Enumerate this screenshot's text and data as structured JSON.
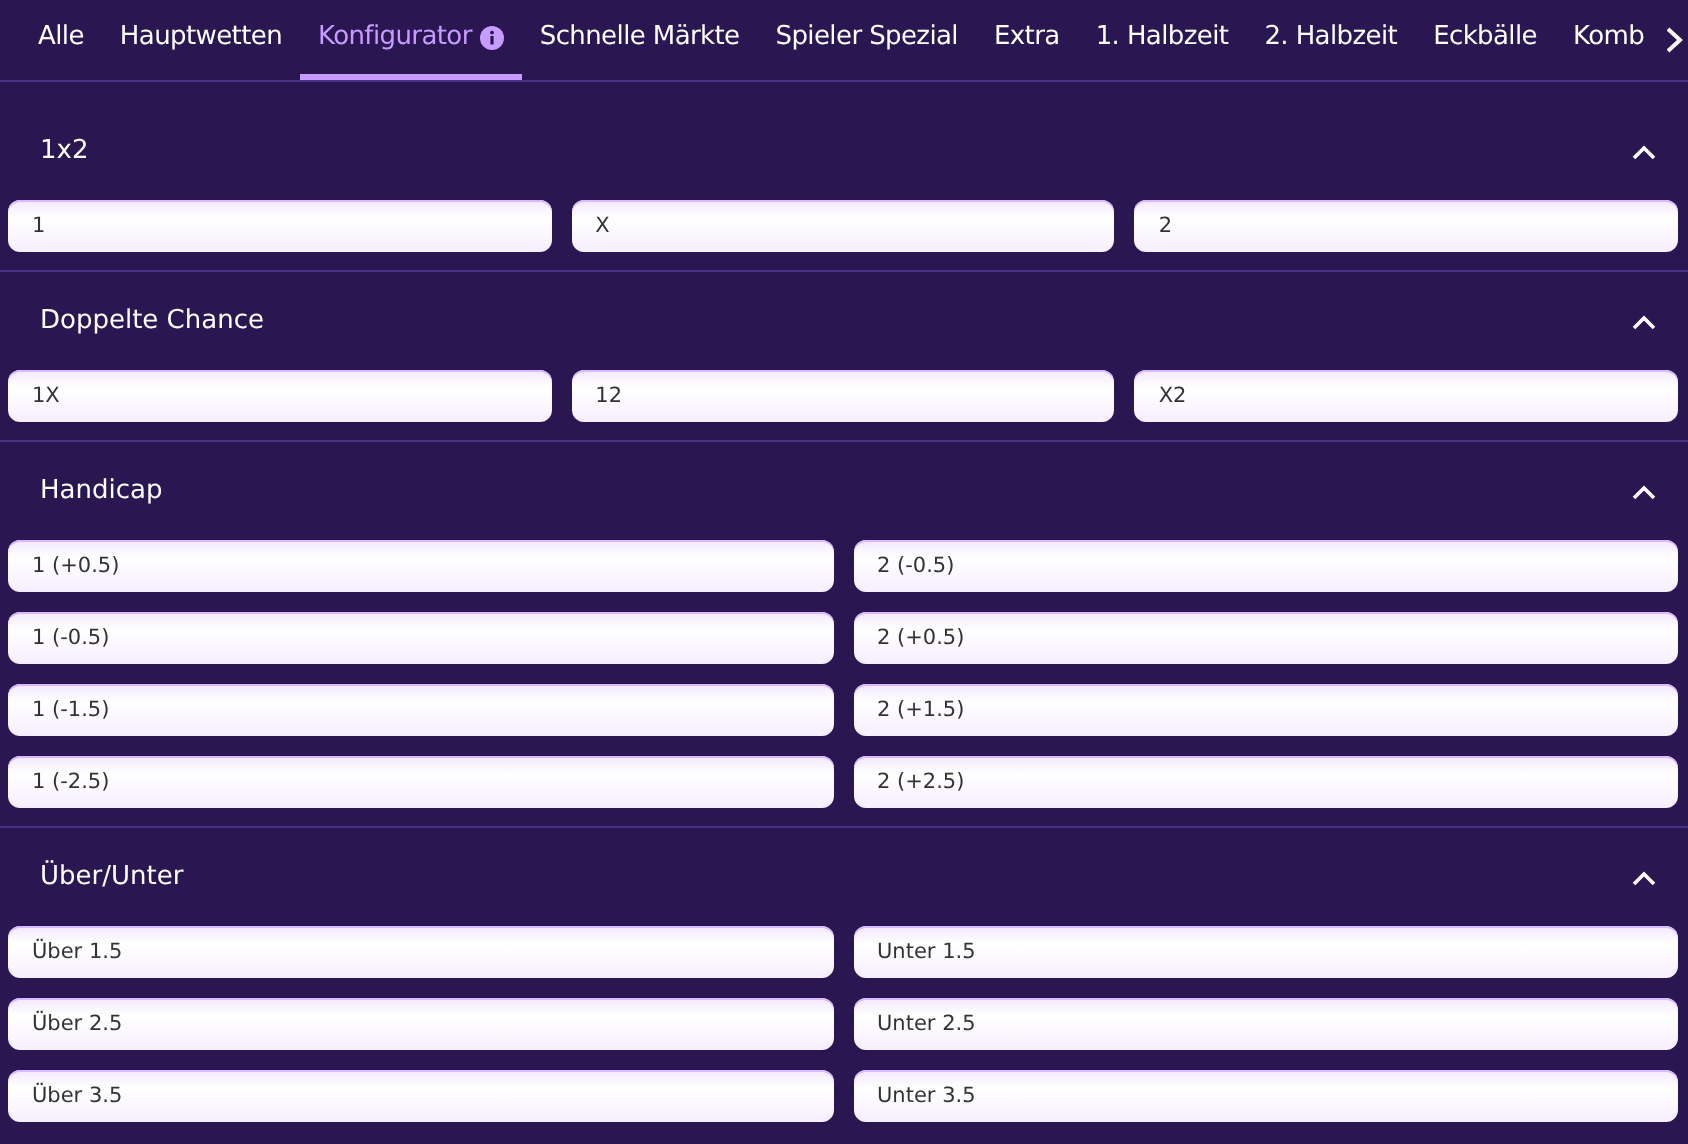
{
  "tabs": [
    {
      "label": "Alle",
      "selected": false,
      "info": false
    },
    {
      "label": "Hauptwetten",
      "selected": false,
      "info": false
    },
    {
      "label": "Konfigurator",
      "selected": true,
      "info": true
    },
    {
      "label": "Schnelle Märkte",
      "selected": false,
      "info": false
    },
    {
      "label": "Spieler Spezial",
      "selected": false,
      "info": false
    },
    {
      "label": "Extra",
      "selected": false,
      "info": false
    },
    {
      "label": "1. Halbzeit",
      "selected": false,
      "info": false
    },
    {
      "label": "2. Halbzeit",
      "selected": false,
      "info": false
    },
    {
      "label": "Eckbälle",
      "selected": false,
      "info": false
    },
    {
      "label": "Komb",
      "selected": false,
      "info": false
    }
  ],
  "sections": [
    {
      "title": "1x2",
      "expanded": true,
      "kind": "triple",
      "options": [
        "1",
        "X",
        "2"
      ]
    },
    {
      "title": "Doppelte Chance",
      "expanded": true,
      "kind": "triple",
      "options": [
        "1X",
        "12",
        "X2"
      ]
    },
    {
      "title": "Handicap",
      "expanded": true,
      "kind": "pair",
      "options": [
        "1 (+0.5)",
        "2 (-0.5)",
        "1 (-0.5)",
        "2 (+0.5)",
        "1 (-1.5)",
        "2 (+1.5)",
        "1 (-2.5)",
        "2 (+2.5)"
      ]
    },
    {
      "title": "Über/Unter",
      "expanded": true,
      "kind": "pair",
      "options": [
        "Über 1.5",
        "Unter 1.5",
        "Über 2.5",
        "Unter 2.5",
        "Über 3.5",
        "Unter 3.5"
      ]
    }
  ]
}
